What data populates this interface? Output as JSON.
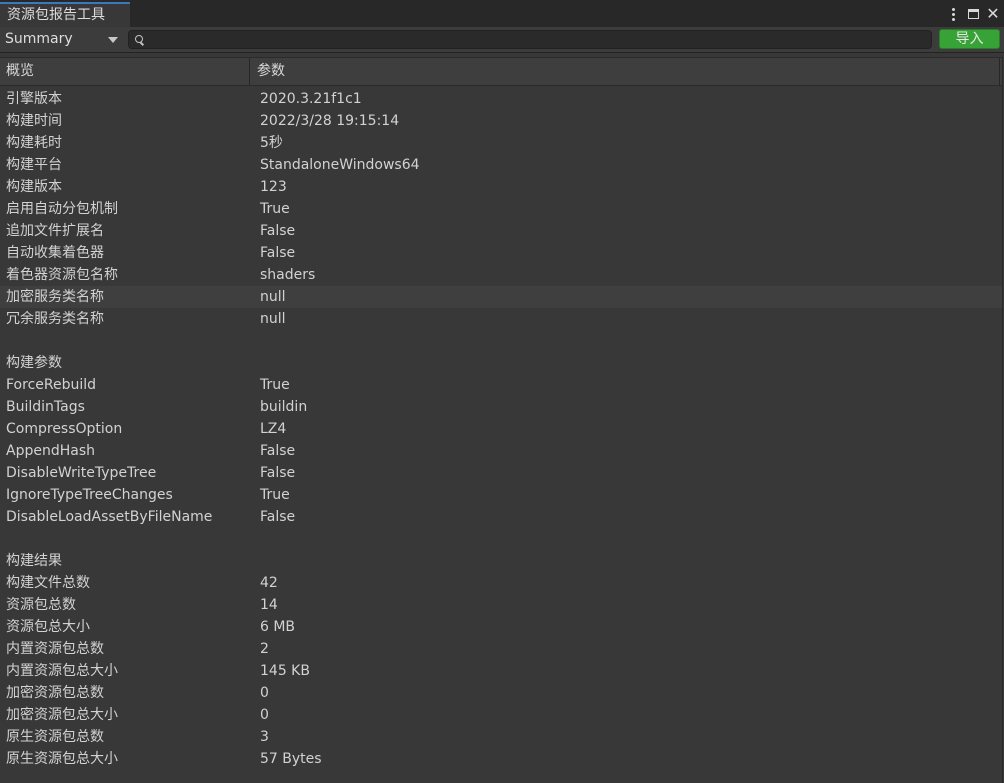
{
  "window": {
    "tab_title": "资源包报告工具"
  },
  "toolbar": {
    "view_selected": "Summary",
    "search_value": "",
    "import_label": "导入",
    "import_color": "#37a337"
  },
  "table": {
    "columns": [
      "概览",
      "参数"
    ],
    "rows": [
      {
        "k": "引擎版本",
        "v": "2020.3.21f1c1"
      },
      {
        "k": "构建时间",
        "v": "2022/3/28 19:15:14"
      },
      {
        "k": "构建耗时",
        "v": "5秒"
      },
      {
        "k": "构建平台",
        "v": "StandaloneWindows64"
      },
      {
        "k": "构建版本",
        "v": "123"
      },
      {
        "k": "启用自动分包机制",
        "v": "True"
      },
      {
        "k": "追加文件扩展名",
        "v": "False"
      },
      {
        "k": "自动收集着色器",
        "v": "False"
      },
      {
        "k": "着色器资源包名称",
        "v": "shaders"
      },
      {
        "k": "加密服务类名称",
        "v": "null",
        "selected": true
      },
      {
        "k": "冗余服务类名称",
        "v": "null"
      },
      {
        "k": "",
        "v": ""
      },
      {
        "k": "构建参数",
        "v": ""
      },
      {
        "k": "ForceRebuild",
        "v": "True"
      },
      {
        "k": "BuildinTags",
        "v": "buildin"
      },
      {
        "k": "CompressOption",
        "v": "LZ4"
      },
      {
        "k": "AppendHash",
        "v": "False"
      },
      {
        "k": "DisableWriteTypeTree",
        "v": "False"
      },
      {
        "k": "IgnoreTypeTreeChanges",
        "v": "True"
      },
      {
        "k": "DisableLoadAssetByFileName",
        "v": "False"
      },
      {
        "k": "",
        "v": ""
      },
      {
        "k": "构建结果",
        "v": ""
      },
      {
        "k": "构建文件总数",
        "v": "42"
      },
      {
        "k": "资源包总数",
        "v": "14"
      },
      {
        "k": "资源包总大小",
        "v": "6 MB"
      },
      {
        "k": "内置资源包总数",
        "v": "2"
      },
      {
        "k": "内置资源包总大小",
        "v": "145 KB"
      },
      {
        "k": "加密资源包总数",
        "v": "0"
      },
      {
        "k": "加密资源包总大小",
        "v": "0"
      },
      {
        "k": "原生资源包总数",
        "v": "3"
      },
      {
        "k": "原生资源包总大小",
        "v": "57 Bytes"
      }
    ]
  }
}
